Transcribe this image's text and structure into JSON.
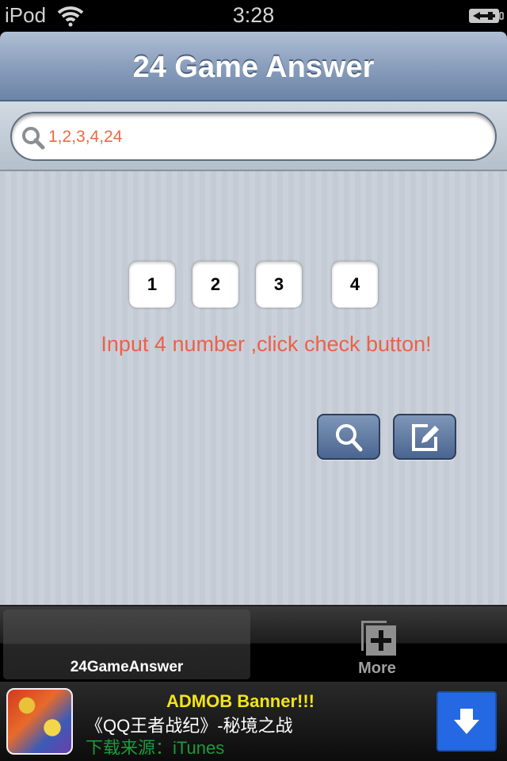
{
  "status_bar": {
    "carrier": "iPod",
    "time": "3:28",
    "wifi_icon": "wifi-icon",
    "battery_icon": "battery-charging-icon"
  },
  "nav": {
    "title": "24 Game Answer"
  },
  "search": {
    "icon": "search-icon",
    "value": "1,2,3,4,24"
  },
  "main": {
    "numbers": [
      "1",
      "2",
      "3",
      "4"
    ],
    "hint": "Input 4 number ,click check button!",
    "buttons": [
      {
        "name": "check",
        "icon": "magnifier-icon"
      },
      {
        "name": "edit",
        "icon": "edit-icon"
      }
    ]
  },
  "tab_bar": {
    "tabs": [
      {
        "label": "24GameAnswer",
        "active": true
      },
      {
        "label": "More",
        "icon": "more-icon",
        "active": false
      }
    ]
  },
  "ad": {
    "title": "ADMOB Banner!!!",
    "subtitle": "《QQ王者战纪》-秘境之战",
    "source": "下载来源：iTunes",
    "download_icon": "download-arrow-icon",
    "colors": {
      "title": "#f2e418",
      "source": "#1e9a3c",
      "button": "#2469e3"
    }
  },
  "colors": {
    "accent_text": "#ec6148",
    "nav_bar": "#8a9fbd"
  }
}
